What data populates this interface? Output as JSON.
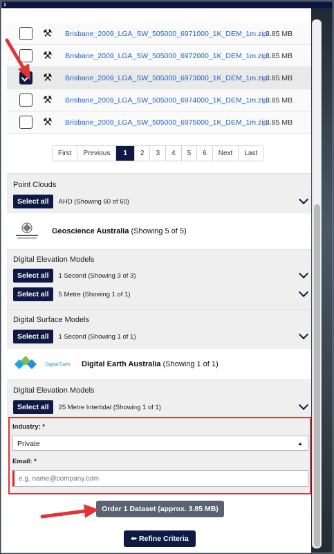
{
  "files": [
    {
      "name": "Brisbane_2009_LGA_SW_505000_6971000_1K_DEM_1m.zip",
      "size": "3.85 MB",
      "checked": false
    },
    {
      "name": "Brisbane_2009_LGA_SW_505000_6972000_1K_DEM_1m.zip",
      "size": "3.85 MB",
      "checked": false
    },
    {
      "name": "Brisbane_2009_LGA_SW_505000_6973000_1K_DEM_1m.zip",
      "size": "3.85 MB",
      "checked": true
    },
    {
      "name": "Brisbane_2009_LGA_SW_505000_6974000_1K_DEM_1m.zip",
      "size": "3.85 MB",
      "checked": false
    },
    {
      "name": "Brisbane_2009_LGA_SW_505000_6975000_1K_DEM_1m.zip",
      "size": "3.85 MB",
      "checked": false
    }
  ],
  "pager": {
    "first": "First",
    "previous": "Previous",
    "pages": [
      "1",
      "2",
      "3",
      "4",
      "5",
      "6"
    ],
    "active": "1",
    "next": "Next",
    "last": "Last"
  },
  "point_clouds": {
    "title": "Point Clouds",
    "select_all": "Select all",
    "text": "AHD (Showing 60 of 60)"
  },
  "ga": {
    "name": "Geoscience Australia",
    "count": "(Showing 5 of 5)",
    "logo_text": "Australian Government"
  },
  "ga_dem": {
    "title": "Digital Elevation Models",
    "rows": [
      {
        "select_all": "Select all",
        "text": "1 Second (Showing 3 of 3)"
      },
      {
        "select_all": "Select all",
        "text": "5 Metre (Showing 1 of 1)"
      }
    ]
  },
  "ga_dsm": {
    "title": "Digital Surface Models",
    "select_all": "Select all",
    "text": "1 Second (Showing 1 of 1)"
  },
  "dea": {
    "name": "Digital Earth Australia",
    "count": "(Showing 1 of 1)",
    "logo_text": "Digital Earth"
  },
  "dea_dem": {
    "title": "Digital Elevation Models",
    "select_all": "Select all",
    "text": "25 Metre Intertidal (Showing 1 of 1)"
  },
  "form": {
    "industry_label": "Industry: *",
    "industry_value": "Private",
    "email_label": "Email: *",
    "email_placeholder": "e.g. name@company.com"
  },
  "order_label": "Order 1 Dataset (approx. 3.85 MB)",
  "refine_label": "Refine Criteria",
  "colors": {
    "navy": "#0e1a45",
    "link": "#1f63c4",
    "annotation": "#e0343a"
  }
}
